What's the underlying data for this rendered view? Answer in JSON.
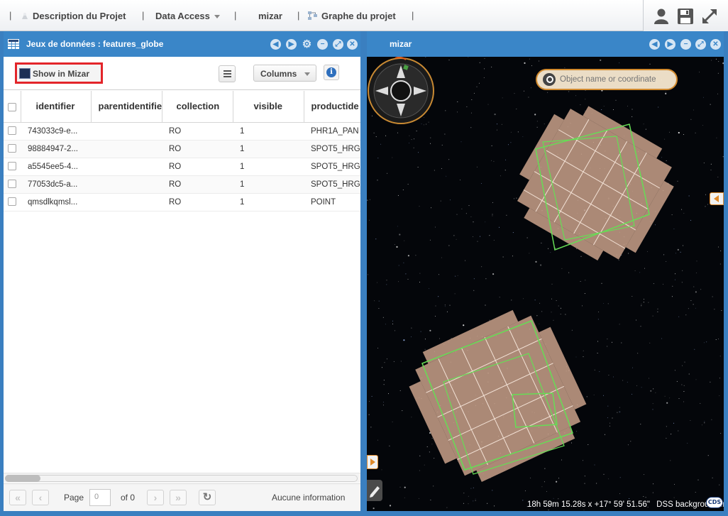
{
  "menu": {
    "items": [
      {
        "label": "Description du Projet"
      },
      {
        "label": "Data Access"
      },
      {
        "label": "mizar"
      },
      {
        "label": "Graphe du projet"
      }
    ]
  },
  "left_panel": {
    "title": "Jeux de données : features_globe",
    "show_in_mizar": "Show in Mizar",
    "columns_button": "Columns",
    "columns": [
      "identifier",
      "parentidentifier",
      "collection",
      "visible",
      "productide"
    ],
    "rows": [
      [
        "743033c9-e...",
        "",
        "RO",
        "1",
        "PHR1A_PAN"
      ],
      [
        "98884947-2...",
        "",
        "RO",
        "1",
        "SPOT5_HRG"
      ],
      [
        "a5545ee5-4...",
        "",
        "RO",
        "1",
        "SPOT5_HRG"
      ],
      [
        "77053dc5-a...",
        "",
        "RO",
        "1",
        "SPOT5_HRG"
      ],
      [
        "qmsdlkqmsl...",
        "",
        "RO",
        "1",
        "POINT"
      ]
    ],
    "pager": {
      "page_label": "Page",
      "page_value": "0",
      "of_label": "of 0",
      "info": "Aucune information"
    }
  },
  "map_panel": {
    "title": "mizar",
    "search_placeholder": "Object name or coordinate",
    "coordinates": "18h 59m 15.28s x +17° 59' 51.56\"",
    "background_credit": "DSS background from",
    "credit_logo": "CDS"
  },
  "colors": {
    "panel_header": "#3a86c8",
    "highlight_border": "#e3252a",
    "accent_orange": "#d28a2e",
    "footprint_fill": "#c9a18a",
    "footprint_outline": "#66dd55"
  }
}
